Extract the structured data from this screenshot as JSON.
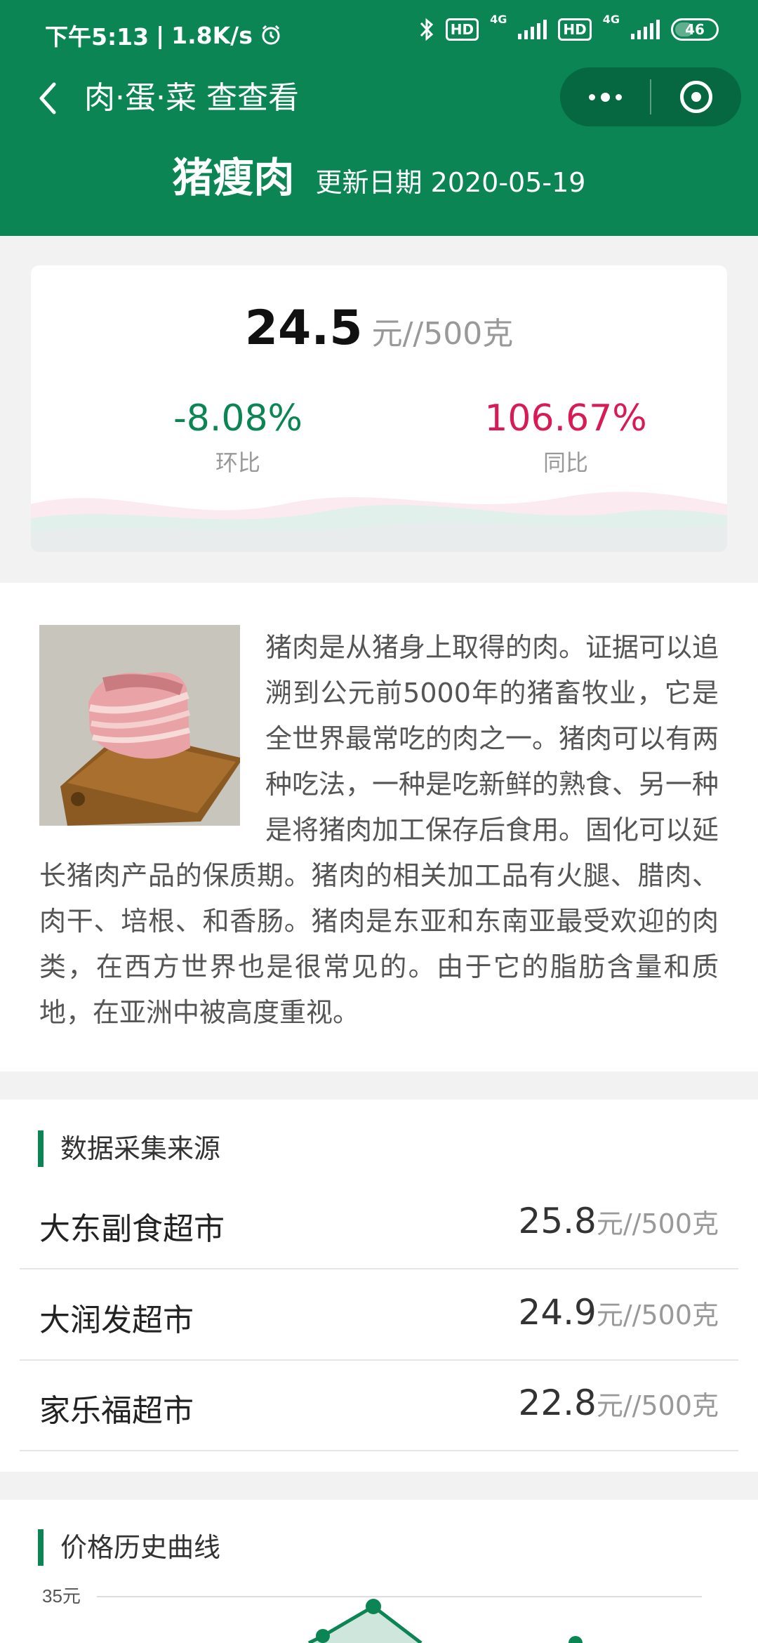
{
  "status": {
    "time": "下午5:13",
    "separator": "|",
    "net_speed": "1.8K/s",
    "net_1": "4G",
    "net_2": "4G",
    "hd_1": "HD",
    "hd_2": "HD",
    "battery": "46"
  },
  "nav": {
    "title": "肉·蛋·菜 查查看"
  },
  "product": {
    "name": "猪瘦肉",
    "update_label": "更新日期",
    "update_date": "2020-05-19"
  },
  "price": {
    "value": "24.5",
    "unit": "元//500克",
    "mom_value": "-8.08%",
    "mom_label": "环比",
    "yoy_value": "106.67%",
    "yoy_label": "同比"
  },
  "description": "猪肉是从猪身上取得的肉。证据可以追溯到公元前5000年的猪畜牧业，它是全世界最常吃的肉之一。猪肉可以有两种吃法，一种是吃新鲜的熟食、另一种是将猪肉加工保存后食用。固化可以延长猪肉产品的保质期。猪肉的相关加工品有火腿、腊肉、肉干、培根、和香肠。猪肉是东亚和东南亚最受欢迎的肉类，在西方世界也是很常见的。由于它的脂肪含量和质地，在亚洲中被高度重视。",
  "sources": {
    "title": "数据采集来源",
    "items": [
      {
        "name": "大东副食超市",
        "price": "25.8",
        "unit": "元//500克"
      },
      {
        "name": "大润发超市",
        "price": "24.9",
        "unit": "元//500克"
      },
      {
        "name": "家乐福超市",
        "price": "22.8",
        "unit": "元//500克"
      }
    ]
  },
  "history": {
    "title": "价格历史曲线",
    "y_tick_top": "35元"
  },
  "colors": {
    "brand": "#0a8553",
    "mom": "#0a8553",
    "yoy": "#d81b56"
  }
}
